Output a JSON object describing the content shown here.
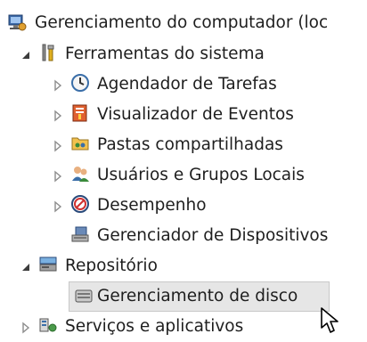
{
  "tree": {
    "root": {
      "label": "Gerenciamento do computador (loc",
      "icon": "computer-management-icon"
    },
    "system_tools": {
      "label": "Ferramentas do sistema",
      "icon": "tools-icon",
      "children": [
        {
          "label": "Agendador de Tarefas",
          "icon": "clock-icon"
        },
        {
          "label": "Visualizador de Eventos",
          "icon": "event-viewer-icon"
        },
        {
          "label": "Pastas compartilhadas",
          "icon": "shared-folders-icon"
        },
        {
          "label": "Usuários e Grupos Locais",
          "icon": "users-icon"
        },
        {
          "label": "Desempenho",
          "icon": "performance-icon"
        },
        {
          "label": "Gerenciador de Dispositivos",
          "icon": "device-manager-icon"
        }
      ]
    },
    "storage": {
      "label": "Repositório",
      "icon": "storage-icon",
      "children": [
        {
          "label": "Gerenciamento de disco",
          "icon": "disk-icon",
          "selected": true
        }
      ]
    },
    "services": {
      "label": "Serviços e aplicativos",
      "icon": "services-icon"
    }
  },
  "colors": {
    "text": "#1e1e1e",
    "selection_bg": "#e6e6e6",
    "selection_border": "#c8c8c8"
  }
}
